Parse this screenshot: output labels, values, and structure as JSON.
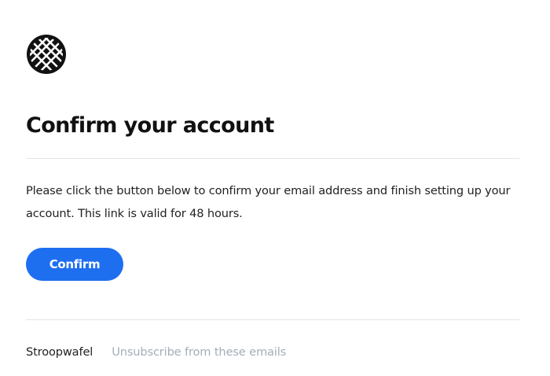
{
  "logo": {
    "icon": "stroopwafel-grid-icon",
    "color": "#111111"
  },
  "email": {
    "title": "Confirm your account",
    "body": "Please click the button below to confirm your email address and finish setting up your account. This link is valid for 48 hours.",
    "confirm_label": "Confirm"
  },
  "footer": {
    "brand": "Stroopwafel",
    "unsubscribe_label": "Unsubscribe from these emails"
  },
  "colors": {
    "accent": "#1e6ef0",
    "muted": "#a3adbb",
    "divider": "#e3e5e8"
  }
}
